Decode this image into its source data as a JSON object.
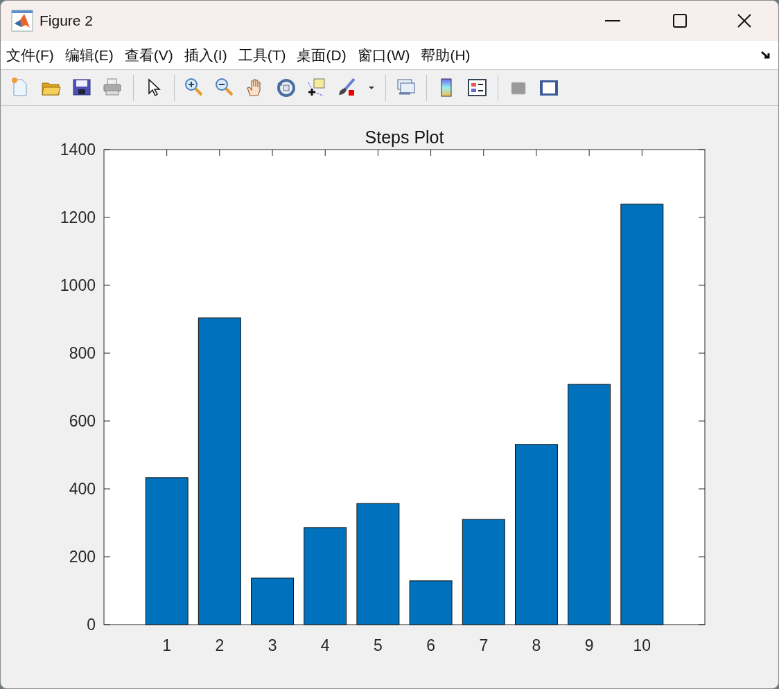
{
  "window": {
    "title": "Figure 2"
  },
  "menu": [
    "文件(F)",
    "编辑(E)",
    "查看(V)",
    "插入(I)",
    "工具(T)",
    "桌面(D)",
    "窗口(W)",
    "帮助(H)"
  ],
  "chart": {
    "chart_data": {
      "type": "bar",
      "title": "Steps Plot",
      "categories": [
        "1",
        "2",
        "3",
        "4",
        "5",
        "6",
        "7",
        "8",
        "9",
        "10"
      ],
      "values": [
        433,
        904,
        137,
        286,
        357,
        129,
        310,
        531,
        708,
        1239
      ],
      "ylim": [
        0,
        1400
      ],
      "yticks": [
        0,
        200,
        400,
        600,
        800,
        1000,
        1200,
        1400
      ]
    }
  }
}
